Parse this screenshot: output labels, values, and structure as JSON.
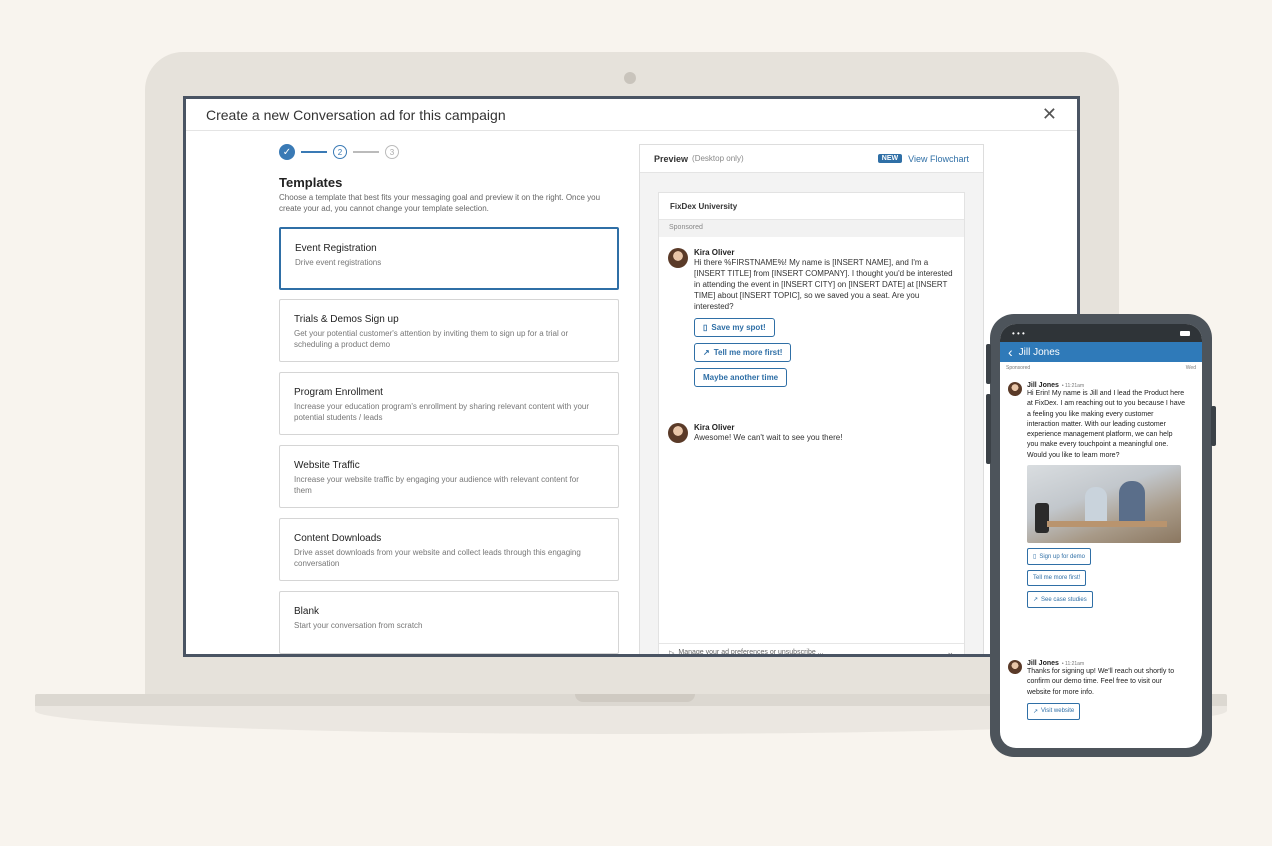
{
  "modal": {
    "title": "Create a new Conversation ad for this campaign",
    "close": "✕"
  },
  "steps": {
    "check": "✓",
    "step2": "2",
    "step3": "3"
  },
  "templates": {
    "heading": "Templates",
    "description": "Choose a template that best fits your messaging goal and preview it on the right. Once you create your ad, you cannot change your template selection.",
    "items": [
      {
        "title": "Event Registration",
        "subtitle": "Drive event registrations"
      },
      {
        "title": "Trials & Demos Sign up",
        "subtitle": "Get your potential customer's attention by inviting them to sign up for a trial or scheduling a product demo"
      },
      {
        "title": "Program Enrollment",
        "subtitle": "Increase your education program's enrollment by sharing relevant content with your potential students / leads"
      },
      {
        "title": "Website Traffic",
        "subtitle": "Increase your website traffic by engaging your audience with relevant content for them"
      },
      {
        "title": "Content Downloads",
        "subtitle": "Drive asset downloads from your website and collect leads through this engaging conversation"
      },
      {
        "title": "Blank",
        "subtitle": "Start your conversation from scratch"
      }
    ]
  },
  "preview": {
    "label": "Preview",
    "note": "(Desktop only)",
    "badge": "NEW",
    "flowchart_link": "View Flowchart",
    "org": "FixDex University",
    "sponsored": "Sponsored",
    "messages": [
      {
        "sender": "Kira Oliver",
        "text": "Hi there %FIRSTNAME%! My name is [INSERT NAME], and I'm a [INSERT TITLE] from [INSERT COMPANY]. I thought you'd be interested in attending the event in [INSERT CITY] on [INSERT DATE] at [INSERT TIME] about [INSERT TOPIC], so we saved you a seat. Are you interested?"
      },
      {
        "sender": "Kira Oliver",
        "text": "Awesome! We can't wait to see you there!"
      }
    ],
    "buttons": [
      "Save my spot!",
      "Tell me more first!",
      "Maybe another time"
    ],
    "footer": "Manage your ad preferences or unsubscribe ..."
  },
  "phone": {
    "status_dots": "• • •",
    "back": "‹",
    "contact": "Jill Jones",
    "sponsored": "Sponsored",
    "day": "Wed",
    "messages": [
      {
        "sender": "Jill Jones",
        "time": "• 11:21am",
        "text": "Hi Erin! My name is Jill and I lead the Product here at FixDex. I am reaching out to you because I have a feeling you like making every customer interaction matter. With our leading customer experience management platform, we can help you make every touchpoint a meaningful one. Would you like to learn more?"
      },
      {
        "sender": "Jill Jones",
        "time": "• 11:21am",
        "text": "Thanks for signing up! We'll reach out shortly to confirm our demo time. Feel free to visit our website for more info."
      }
    ],
    "buttons": [
      "Sign up for demo",
      "Tell me more first!",
      "See case studies"
    ],
    "visit_button": "Visit website"
  },
  "colors": {
    "accent": "#2f6fa6",
    "nav": "#2f7ab9",
    "background": "#f8f4ee"
  }
}
